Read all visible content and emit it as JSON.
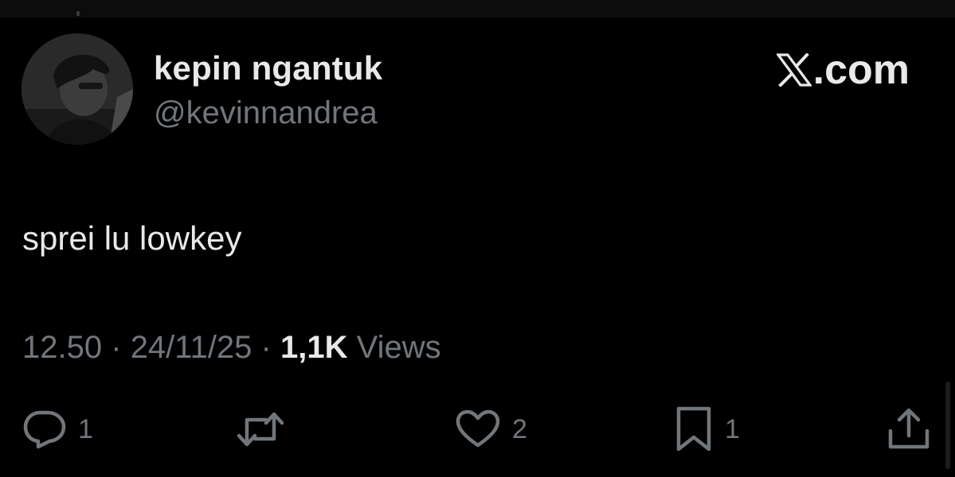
{
  "author": {
    "display_name": "kepin ngantuk",
    "handle": "@kevinnandrea"
  },
  "brand": {
    "logo_icon": "x-logo-icon",
    "domain_suffix": ".com"
  },
  "tweet": {
    "text": "sprei lu lowkey",
    "time": "12.50",
    "date": "24/11/25",
    "separator": "·",
    "views_count": "1,1K",
    "views_label": "Views"
  },
  "actions": {
    "reply": {
      "icon": "reply-icon",
      "count": "1"
    },
    "retweet": {
      "icon": "retweet-icon"
    },
    "like": {
      "icon": "heart-icon",
      "count": "2"
    },
    "bookmark": {
      "icon": "bookmark-icon",
      "count": "1"
    },
    "share": {
      "icon": "share-icon"
    }
  },
  "colors": {
    "background": "#000000",
    "primary_text": "#e7e9ea",
    "secondary_text": "#71767b"
  }
}
